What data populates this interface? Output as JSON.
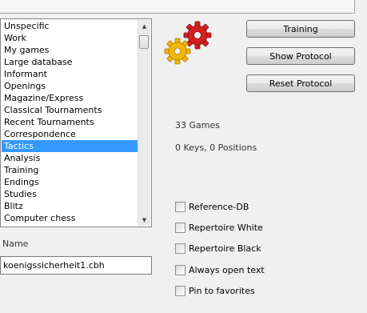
{
  "databases": {
    "items": [
      "Unspecific",
      "Work",
      "My games",
      "Large database",
      "Informant",
      "Openings",
      "Magazine/Express",
      "Classical Tournaments",
      "Recent Tournaments",
      "Correspondence",
      "Tactics",
      "Analysis",
      "Training",
      "Endings",
      "Studies",
      "Blitz",
      "Computer chess"
    ],
    "selected_index": 10
  },
  "name": {
    "label": "Name",
    "value": "koenigssicherheit1.cbh"
  },
  "buttons": {
    "training": "Training",
    "show_protocol": "Show Protocol",
    "reset_protocol": "Reset Protocol"
  },
  "info": {
    "games": "33 Games",
    "keys": "0 Keys, 0 Positions"
  },
  "checkboxes": [
    {
      "label": "Reference-DB",
      "checked": false
    },
    {
      "label": "Repertoire White",
      "checked": false
    },
    {
      "label": "Repertoire Black",
      "checked": false
    },
    {
      "label": "Always open text",
      "checked": false
    },
    {
      "label": "Pin to favorites",
      "checked": false
    }
  ],
  "icons": {
    "gears": "gears-icon",
    "scroll_up": "scroll-up-arrow-icon",
    "scroll_down": "scroll-down-arrow-icon"
  },
  "colors": {
    "selection": "#3399ff",
    "gear_red": "#d42020",
    "gear_yellow": "#f2b705"
  }
}
